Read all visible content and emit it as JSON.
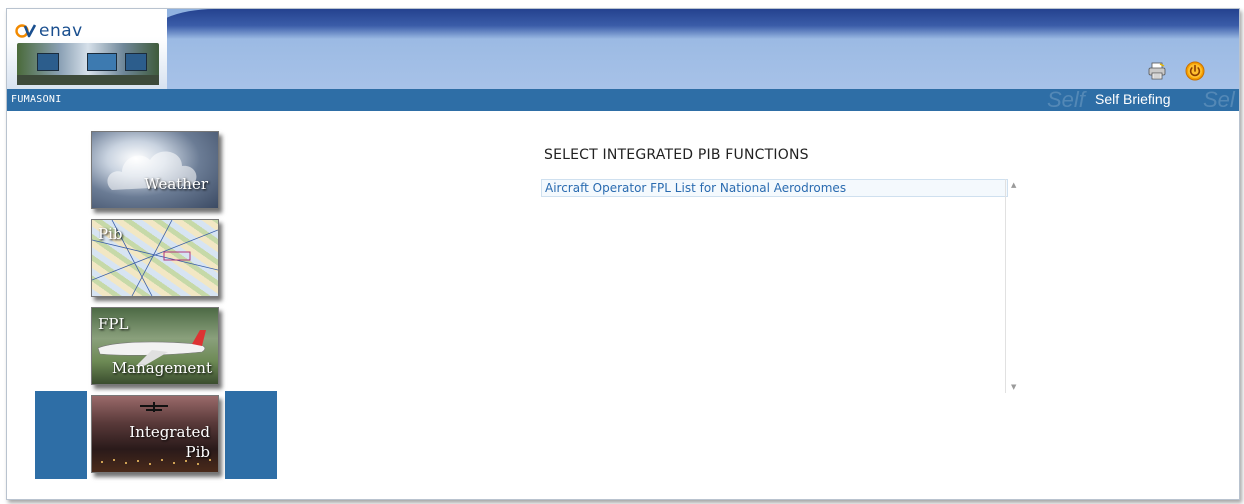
{
  "header": {
    "logo_text": "enav",
    "username": "FUMASONI",
    "app_title": "Self Briefing",
    "ghost_left": "Self",
    "ghost_right": "Sel",
    "brand_colors": {
      "strip": "#2e6ea6",
      "banner_dark": "#24428f",
      "logo_orange": "#f28a00"
    }
  },
  "toolbar": {
    "icons": [
      "printer-icon",
      "power-icon"
    ]
  },
  "menu": {
    "items": [
      {
        "label": "Weather",
        "selected": false
      },
      {
        "label": "Pib",
        "selected": false
      },
      {
        "label_line1": "FPL",
        "label_line2": "Management",
        "selected": false
      },
      {
        "label_line1": "Integrated",
        "label_line2": "Pib",
        "selected": true
      }
    ]
  },
  "main": {
    "title": "SELECT INTEGRATED PIB FUNCTIONS",
    "functions": [
      "Aircraft Operator FPL List for National Aerodromes"
    ]
  }
}
